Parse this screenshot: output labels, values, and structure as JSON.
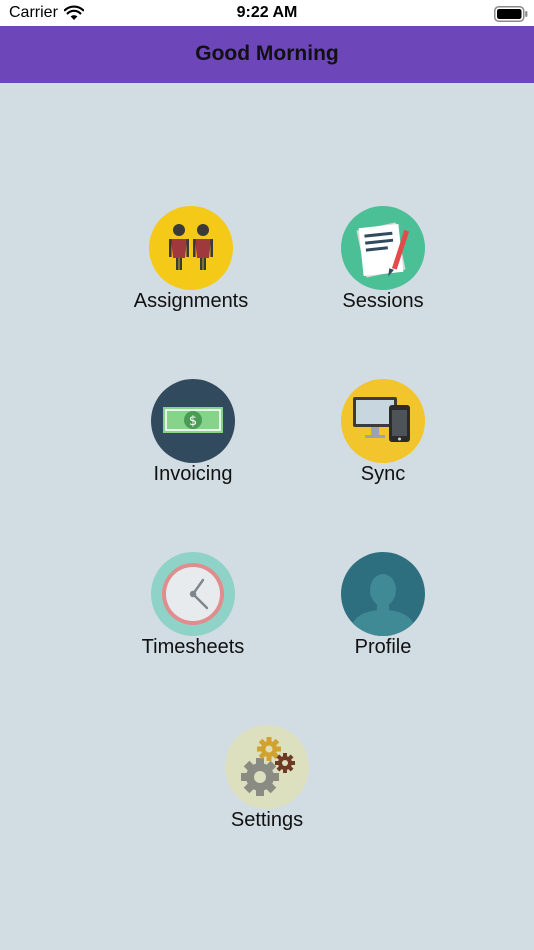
{
  "status_bar": {
    "carrier": "Carrier",
    "time": "9:22 AM",
    "icons": [
      "wifi-icon",
      "battery-icon"
    ]
  },
  "nav": {
    "title": "Good Morning",
    "background": "#6d46b9"
  },
  "menu": {
    "items": [
      {
        "label": "Assignments",
        "icon": "people-icon",
        "color": "#f4c918"
      },
      {
        "label": "Sessions",
        "icon": "document-icon",
        "color": "#4bbf95"
      },
      {
        "label": "Invoicing",
        "icon": "money-icon",
        "color": "#324a5e"
      },
      {
        "label": "Sync",
        "icon": "devices-icon",
        "color": "#f2c52c"
      },
      {
        "label": "Timesheets",
        "icon": "clock-icon",
        "color": "#8fd2c7"
      },
      {
        "label": "Profile",
        "icon": "user-icon",
        "color": "#2e6f7f"
      },
      {
        "label": "Settings",
        "icon": "gears-icon",
        "color": "#dde0be"
      }
    ]
  }
}
